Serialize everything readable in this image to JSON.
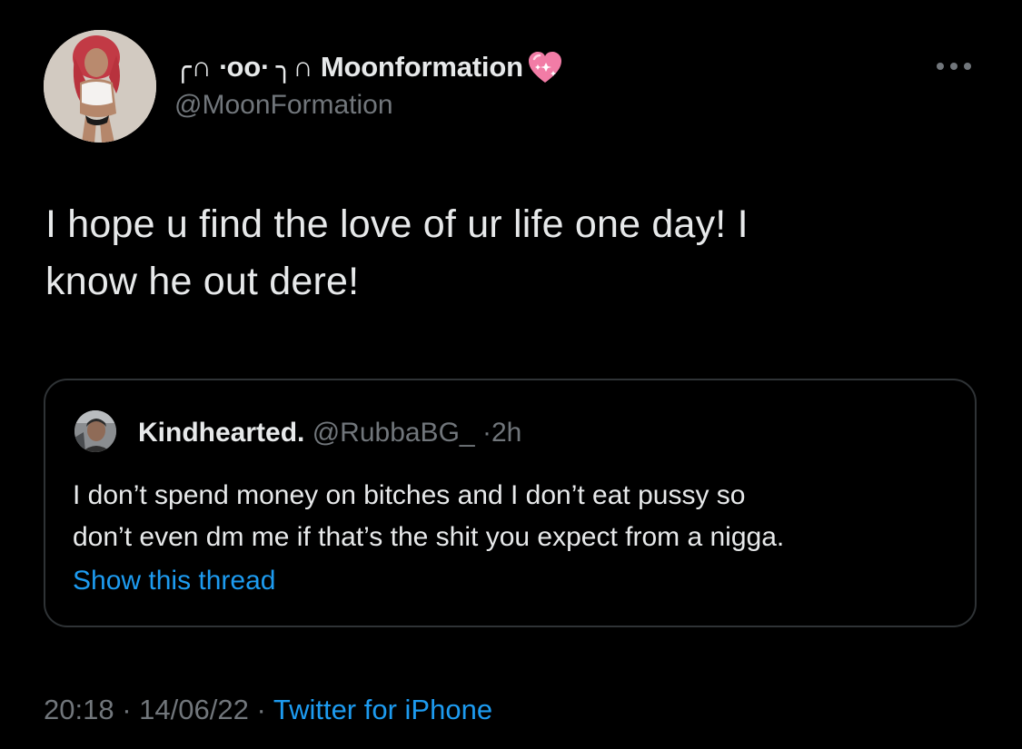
{
  "author": {
    "display_name": "╭∩ ∙oo∙ ╮∩ Moonformation",
    "heart_emoji": "pink-heart-emoji",
    "handle": "@MoonFormation",
    "avatar": "profile-photo"
  },
  "tweet": {
    "text_line1": "I hope u find the love of ur life one day! I",
    "text_line2": "know he out dere!"
  },
  "quoted_tweet": {
    "name": "Kindhearted.",
    "handle": "@RubbaBG_",
    "separator": "·",
    "time": "2h",
    "text_line1": "I don’t spend money on bitches and I don’t eat pussy so",
    "text_line2": "don’t even dm me if that’s the shit you expect from a nigga.",
    "show_thread": "Show this thread"
  },
  "meta": {
    "time": "20:18",
    "separator1": "·",
    "date": "14/06/22",
    "separator2": "·",
    "source": "Twitter for iPhone"
  },
  "icons": {
    "more": "more-options-icon"
  },
  "colors": {
    "background": "#000000",
    "primary_text": "#e7e9ea",
    "secondary_text": "#71767b",
    "link": "#1d9bf0",
    "card_border": "#2f3336"
  }
}
